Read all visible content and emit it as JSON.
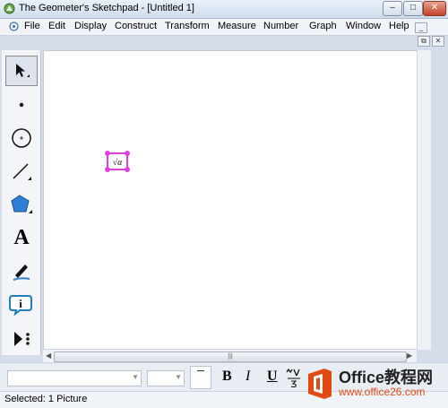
{
  "window": {
    "title": "The Geometer's Sketchpad - [Untitled 1]",
    "minimize_glyph": "–",
    "restore_glyph": "□",
    "close_glyph": "✕"
  },
  "menu": {
    "items": [
      "File",
      "Edit",
      "Display",
      "Construct",
      "Transform",
      "Measure",
      "Number",
      "Graph",
      "Window",
      "Help"
    ],
    "mdi_minimize": "_",
    "mdi_restore": "⧉",
    "mdi_close": "✕"
  },
  "toolbox": {
    "tools": [
      {
        "name": "arrow-tool-icon",
        "selected": true
      },
      {
        "name": "point-tool-icon",
        "selected": false
      },
      {
        "name": "compass-tool-icon",
        "selected": false
      },
      {
        "name": "straightedge-tool-icon",
        "selected": false
      },
      {
        "name": "polygon-tool-icon",
        "selected": false
      },
      {
        "name": "text-tool-icon",
        "selected": false
      },
      {
        "name": "marker-tool-icon",
        "selected": false
      },
      {
        "name": "information-tool-icon",
        "selected": false
      },
      {
        "name": "custom-tool-icon",
        "selected": false
      }
    ],
    "text_tool_glyph": "A",
    "info_tool_glyph": "i"
  },
  "canvas": {
    "picture_label": "√α",
    "selection_color": "#e040e0"
  },
  "text_toolbar": {
    "font_name": "",
    "font_size": "",
    "bold": "B",
    "italic": "I",
    "underline": "U"
  },
  "status": {
    "text": "Selected: 1 Picture"
  },
  "watermark": {
    "brand": "Office教程网",
    "url": "www.office26.com",
    "accent_color": "#e14b12"
  },
  "colors": {
    "chrome": "#d4dde9",
    "canvas": "#ffffff"
  }
}
